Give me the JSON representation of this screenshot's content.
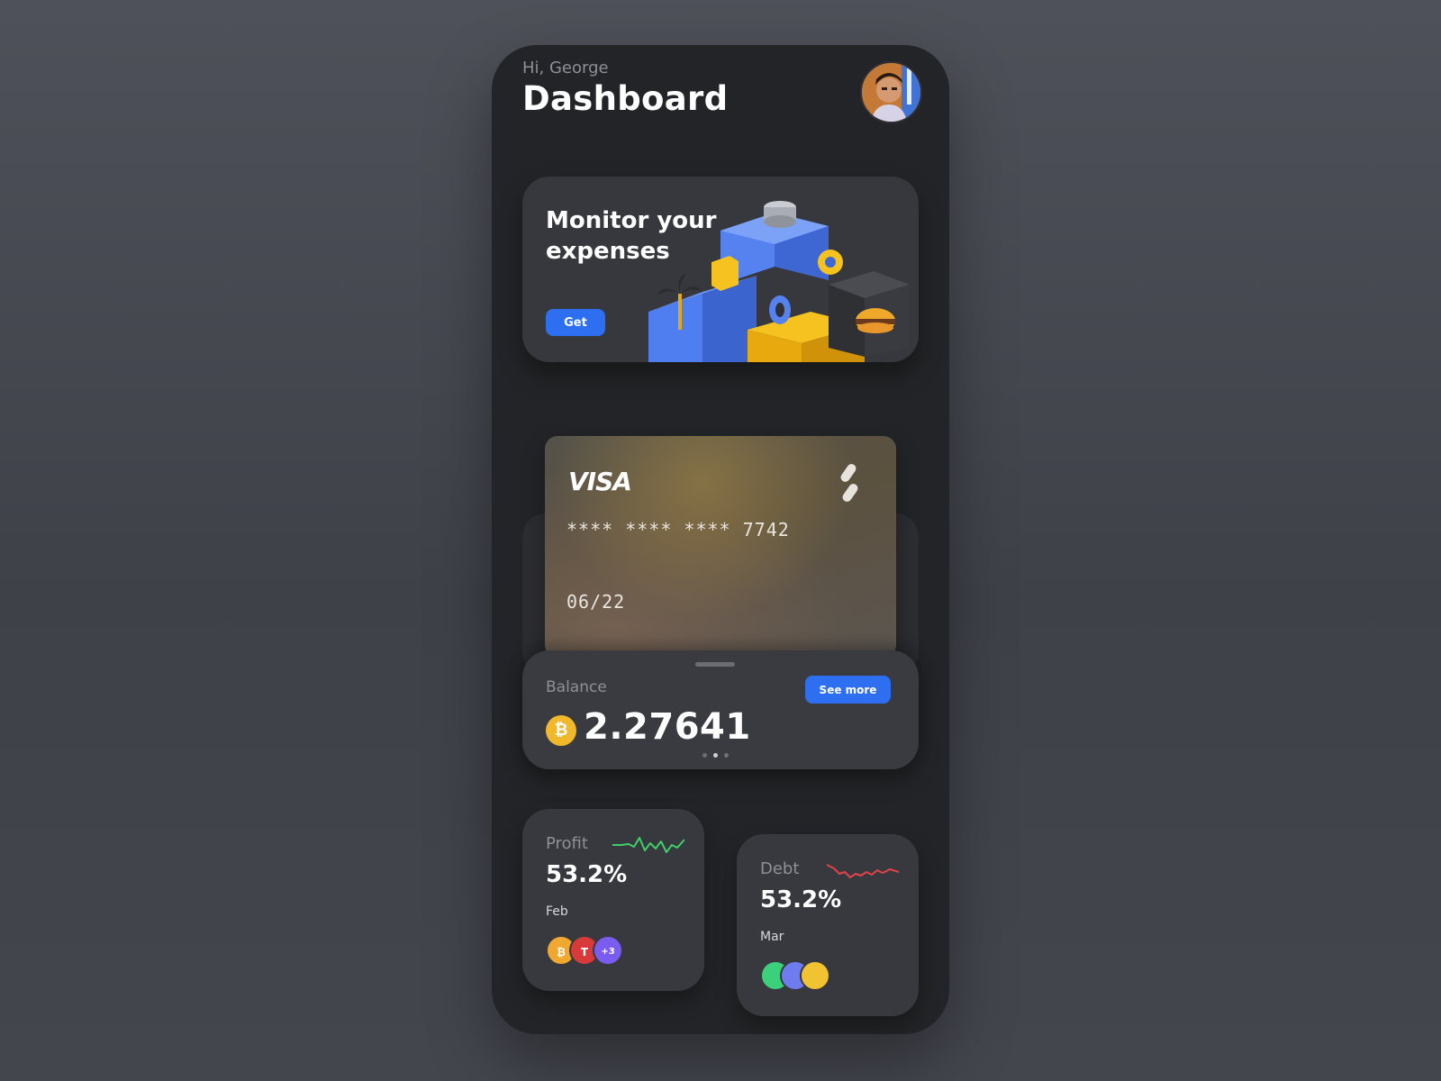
{
  "header": {
    "greeting": "Hi, George",
    "title": "Dashboard"
  },
  "promo": {
    "title": "Monitor your expenses",
    "button_label": "Get"
  },
  "card": {
    "brand": "VISA",
    "number": "**** **** **** 7742",
    "expiry": "06/22"
  },
  "balance": {
    "label": "Balance",
    "value": "2.27641",
    "currency_symbol": "₿",
    "see_more_label": "See more",
    "carousel": {
      "total": 3,
      "active_index": 1
    }
  },
  "stats": [
    {
      "label": "Profit",
      "value": "53.2%",
      "month": "Feb",
      "trend_color": "#3ecf6a",
      "coins": [
        {
          "symbol": "₿",
          "color": "#f0a830"
        },
        {
          "symbol": "T",
          "color": "#d8393a"
        },
        {
          "symbol": "+3",
          "color": "#7b5cf0"
        }
      ]
    },
    {
      "label": "Debt",
      "value": "53.2%",
      "month": "Mar",
      "trend_color": "#e0434b",
      "coins": [
        {
          "symbol": "",
          "color": "#3bd17a"
        },
        {
          "symbol": "",
          "color": "#6e7cf0"
        },
        {
          "symbol": "",
          "color": "#f1c232"
        }
      ]
    }
  ],
  "colors": {
    "accent": "#2d6ff0",
    "background": "#232427",
    "panel": "#38393e"
  }
}
